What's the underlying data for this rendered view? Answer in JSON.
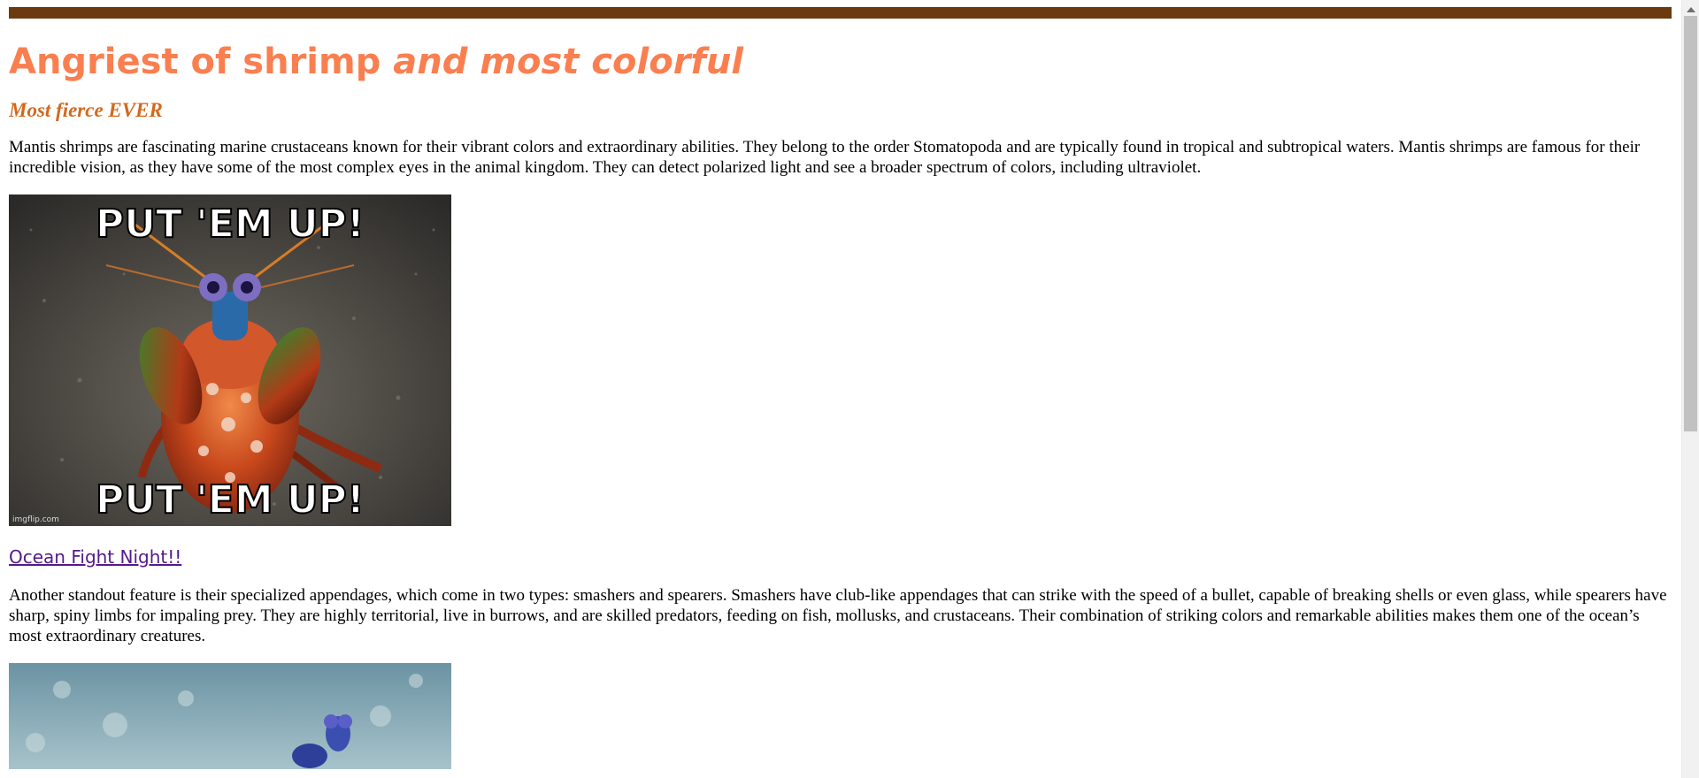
{
  "page": {
    "title_main": "Angriest of shrimp ",
    "title_emphasis": "and most colorful",
    "subtitle": "Most fierce EVER",
    "paragraph_1": "Mantis shrimps are fascinating marine crustaceans known for their vibrant colors and extraordinary abilities. They belong to the order Stomatopoda and are typically found in tropical and subtropical waters. Mantis shrimps are famous for their incredible vision, as they have some of the most complex eyes in the animal kingdom. They can detect polarized light and see a broader spectrum of colors, including ultraviolet.",
    "meme_top_text": "PUT 'EM UP!",
    "meme_bottom_text": "PUT 'EM UP!",
    "meme_watermark": "imgflip.com",
    "link_text": "Ocean Fight Night!!",
    "paragraph_2": "Another standout feature is their specialized appendages, which come in two types: smashers and spearers. Smashers have club-like appendages that can strike with the speed of a bullet, capable of breaking shells or even glass, while spearers have sharp, spiny limbs for impaling prey. They are highly territorial, live in burrows, and are skilled predators, feeding on fish, mollusks, and crustaceans. Their combination of striking colors and remarkable abilities makes them one of the ocean’s most extraordinary creatures."
  },
  "colors": {
    "top_bar": "#6b3a0e",
    "title": "#fa7f50",
    "subtitle": "#d2691e",
    "link_visited": "#551a8b"
  },
  "icons": {
    "scroll_up": "scroll-up-arrow-icon"
  }
}
